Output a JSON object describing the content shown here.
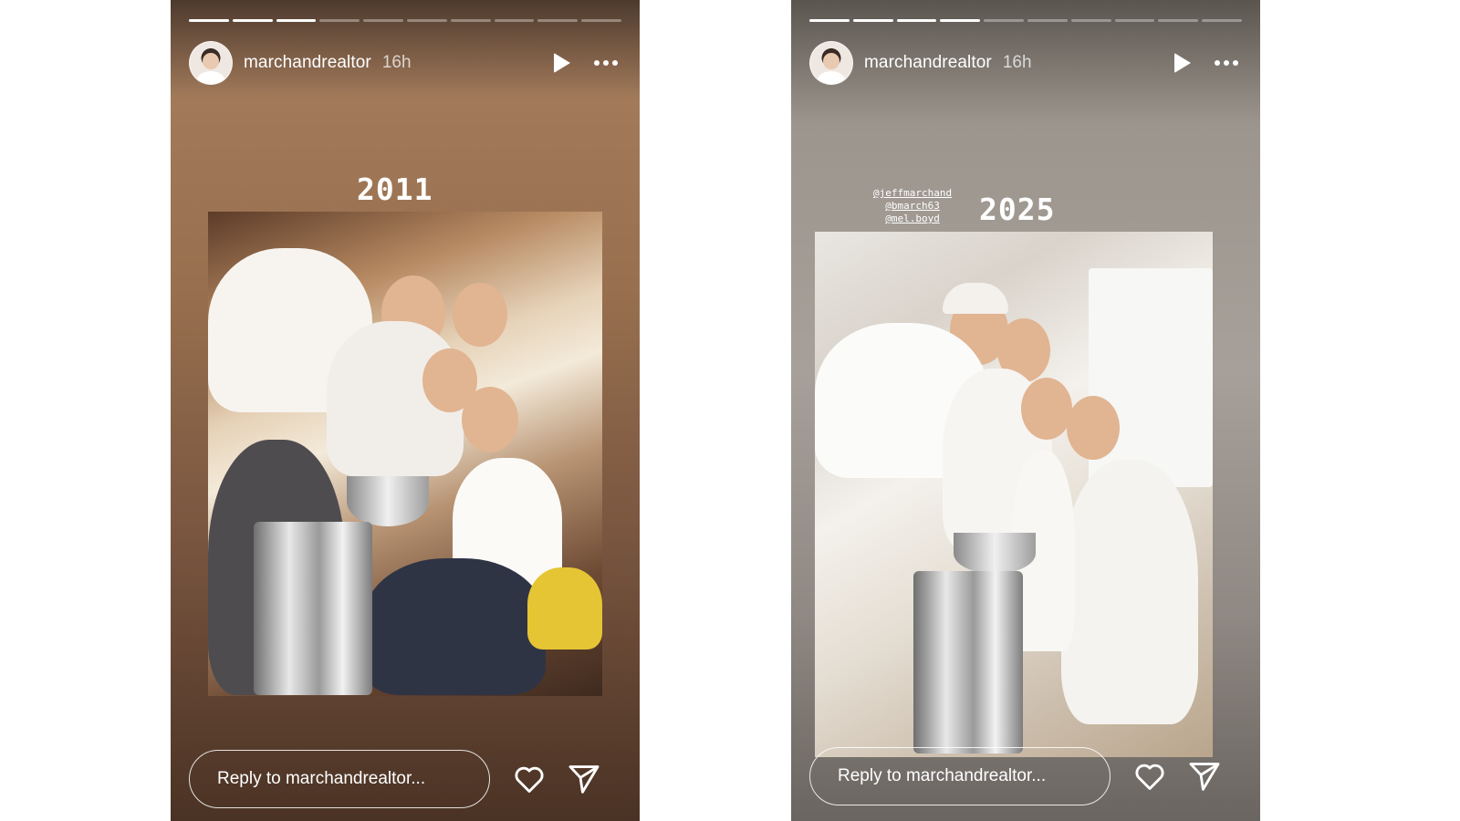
{
  "stories": [
    {
      "username": "marchandrealtor",
      "time": "16h",
      "year_label": "2011",
      "mentions": [],
      "reply_placeholder": "Reply to marchandrealtor..."
    },
    {
      "username": "marchandrealtor",
      "time": "16h",
      "year_label": "2025",
      "mentions": [
        "@jeffmarchand",
        "@bmarch63",
        "@mel.boyd"
      ],
      "reply_placeholder": "Reply to marchandrealtor..."
    }
  ],
  "icons": {
    "play": "play-icon",
    "more": "more-options-icon",
    "like": "heart-icon",
    "send": "send-icon"
  },
  "colors": {
    "left_story_tone": "#98704f",
    "right_story_tone": "#a7a09a",
    "text": "#ffffff"
  }
}
